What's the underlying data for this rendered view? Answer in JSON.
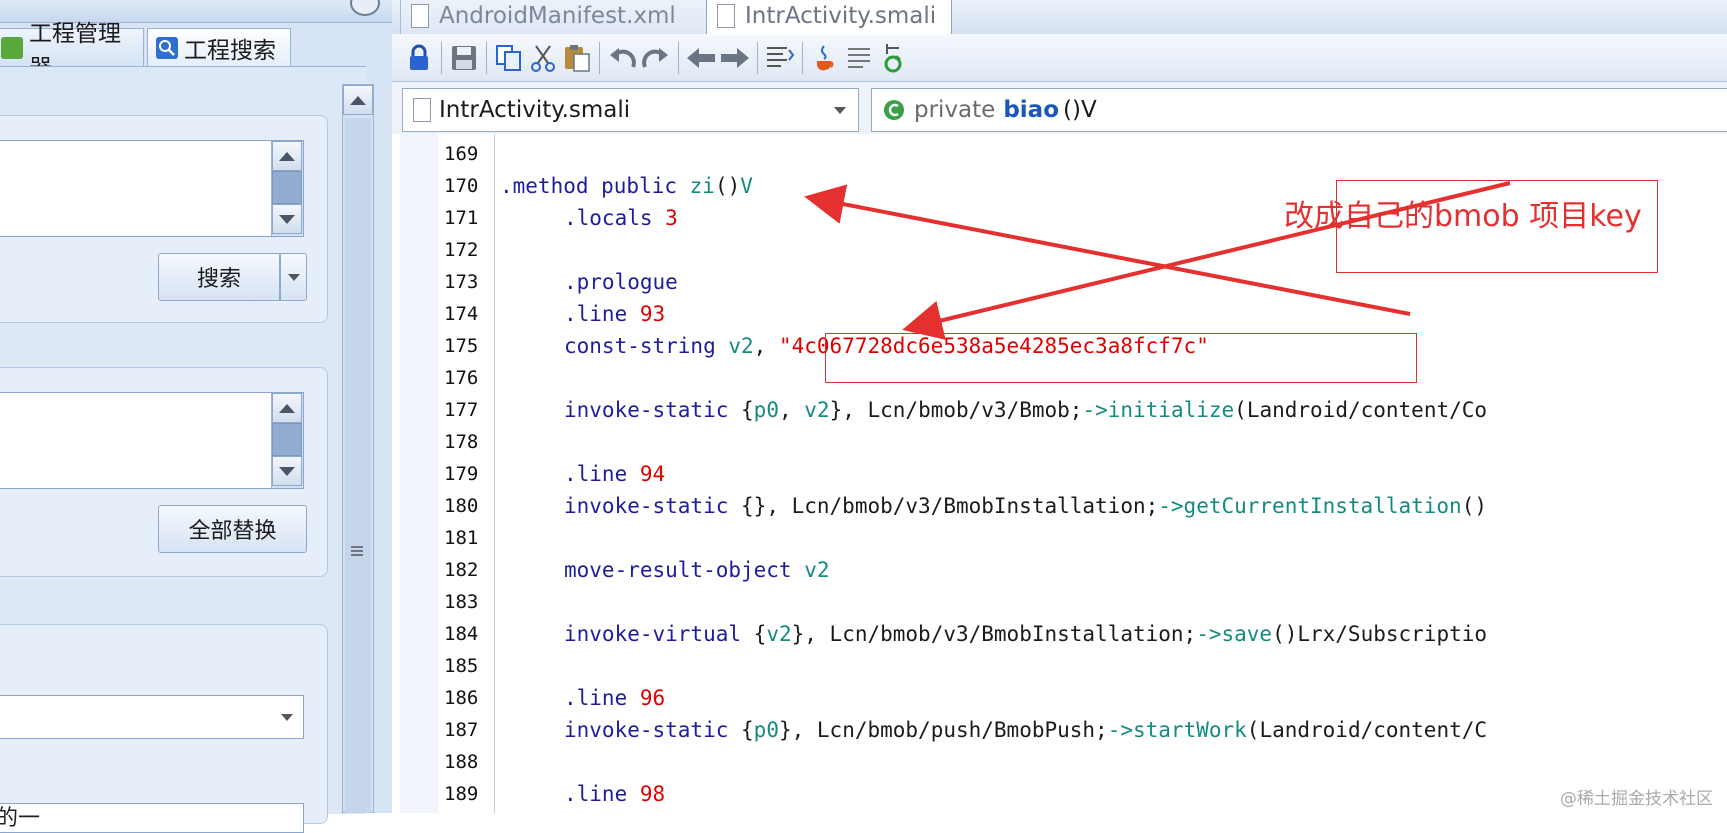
{
  "left_panel": {
    "tabs": [
      {
        "label": "工程管理器",
        "icon": "project-manager-icon"
      },
      {
        "label": "工程搜索",
        "icon": "magnifier-icon"
      }
    ],
    "search_button_label": "搜索",
    "replace_all_button_label": "全部替换",
    "bottom_text": "的一"
  },
  "editor_tabs": [
    {
      "label": "AndroidManifest.xml",
      "active": false
    },
    {
      "label": "IntrActivity.smali",
      "active": true
    }
  ],
  "toolbar_icons": [
    "lock-icon",
    "save-icon",
    "copy-icon",
    "cut-icon",
    "paste-icon",
    "undo-icon",
    "redo-icon",
    "back-icon",
    "forward-icon",
    "format-icon",
    "java-icon",
    "text-icon",
    "refresh-icon"
  ],
  "file_selector": {
    "value": "IntrActivity.smali"
  },
  "method_selector": {
    "visibility": "private",
    "name": "biao",
    "signature": "()V"
  },
  "code": {
    "line_numbers": [
      "169",
      "170",
      "171",
      "172",
      "173",
      "174",
      "175",
      "176",
      "177",
      "178",
      "179",
      "180",
      "181",
      "182",
      "183",
      "184",
      "185",
      "186",
      "187",
      "188",
      "189"
    ],
    "l170": {
      "a": ".method public ",
      "b": "zi",
      "c": "()",
      "d": "V"
    },
    "l171": {
      "a": ".locals ",
      "b": "3"
    },
    "l173": {
      "a": ".prologue"
    },
    "l174": {
      "a": ".line ",
      "b": "93"
    },
    "l175": {
      "a": "const-string ",
      "b": "v2",
      "c": ", ",
      "d": "\"4c067728dc6e538a5e4285ec3a8fcf7c\""
    },
    "l177": {
      "a": "invoke-static ",
      "b": "{",
      "c": "p0",
      "d": ", ",
      "e": "v2",
      "f": "}",
      "g": ", Lcn/bmob/v3/Bmob;",
      "h": "->",
      "i": "initialize",
      "j": "(Landroid/content/Co"
    },
    "l179": {
      "a": ".line ",
      "b": "94"
    },
    "l180": {
      "a": "invoke-static ",
      "b": "{}",
      "c": ", Lcn/bmob/v3/BmobInstallation;",
      "d": "->",
      "e": "getCurrentInstallation",
      "f": "()"
    },
    "l182": {
      "a": "move-result-object ",
      "b": "v2"
    },
    "l184": {
      "a": "invoke-virtual ",
      "b": "{",
      "c": "v2",
      "d": "}",
      "e": ", Lcn/bmob/v3/BmobInstallation;",
      "f": "->",
      "g": "save",
      "h": "()Lrx/Subscriptio"
    },
    "l186": {
      "a": ".line ",
      "b": "96"
    },
    "l187": {
      "a": "invoke-static ",
      "b": "{",
      "c": "p0",
      "d": "}",
      "e": ", Lcn/bmob/push/BmobPush;",
      "f": "->",
      "g": "startWork",
      "h": "(Landroid/content/C"
    },
    "l189": {
      "a": ".line ",
      "b": "98"
    }
  },
  "annotation": {
    "text": "改成自己的bmob 项目key",
    "color": "#e53030"
  },
  "watermark": "@稀土掘金技术社区"
}
